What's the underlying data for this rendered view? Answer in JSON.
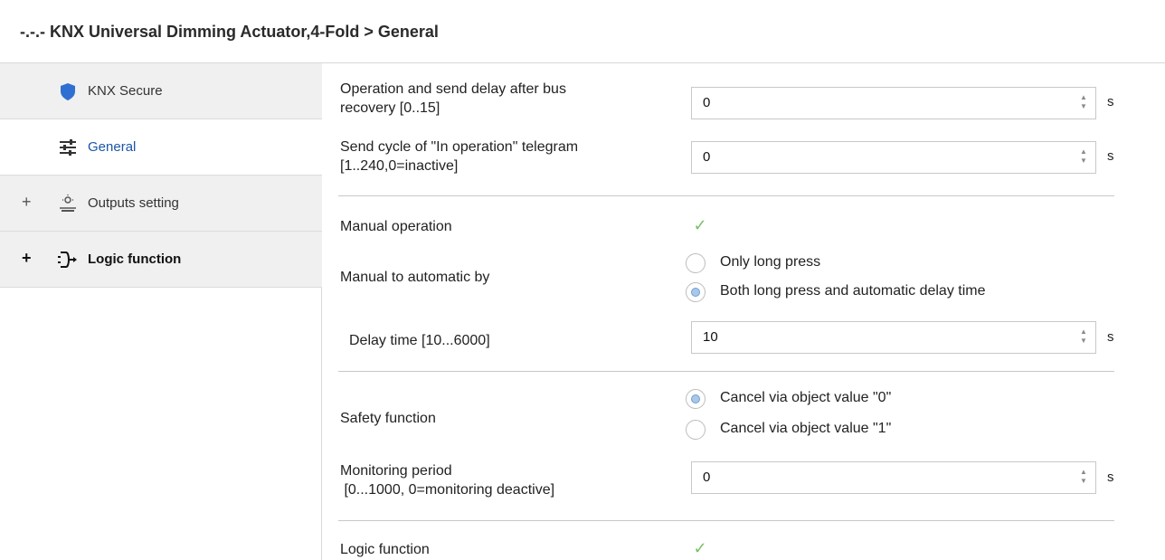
{
  "title": "-.-.- KNX Universal Dimming Actuator,4-Fold > General",
  "sidebar": {
    "items": [
      {
        "label": "KNX Secure",
        "icon": "shield-icon",
        "expander": ""
      },
      {
        "label": "General",
        "icon": "sliders-icon",
        "expander": ""
      },
      {
        "label": "Outputs setting",
        "icon": "lamp-icon",
        "expander": "+"
      },
      {
        "label": "Logic function",
        "icon": "logic-icon",
        "expander": "+"
      }
    ]
  },
  "params": {
    "op_delay": {
      "label_1": "Operation and send delay after bus",
      "label_2": "recovery [0..15]",
      "value": "0",
      "unit": "s"
    },
    "send_cycle": {
      "label_1": "Send cycle of  \"In operation\" telegram",
      "label_2": "[1..240,0=inactive]",
      "value": "0",
      "unit": "s"
    },
    "manual_operation": {
      "label": "Manual operation",
      "checked": true
    },
    "manual_to_auto": {
      "label": "Manual to automatic by",
      "options": [
        "Only long press",
        "Both long press and automatic delay time"
      ],
      "selected": 1
    },
    "delay_time": {
      "label": "Delay time [10...6000]",
      "value": "10",
      "unit": "s"
    },
    "safety": {
      "label": "Safety function",
      "options": [
        "Cancel via object value \"0\"",
        "Cancel via object value \"1\""
      ],
      "selected": 0
    },
    "monitoring": {
      "label_1": "Monitoring period",
      "label_2": " [0...1000, 0=monitoring deactive]",
      "value": "0",
      "unit": "s"
    },
    "logic_function": {
      "label": "Logic function",
      "checked": true
    }
  },
  "colors": {
    "accent": "#1a56a8",
    "check": "#7dbf6b",
    "shield": "#2f6fd1"
  },
  "spin_arrows": {
    "up": "▲",
    "down": "▼"
  },
  "check_glyph": "✓"
}
